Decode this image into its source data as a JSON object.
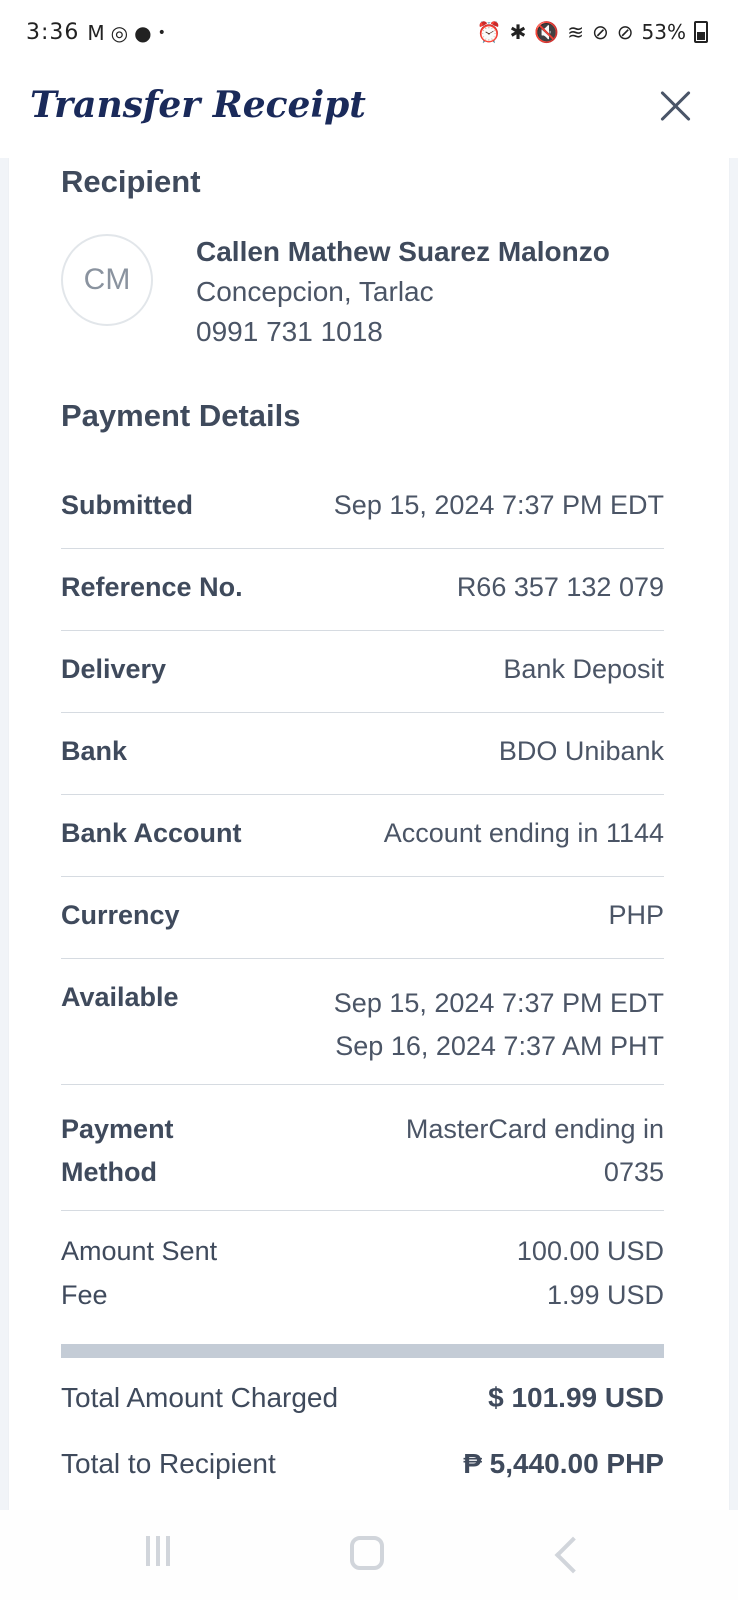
{
  "status_bar": {
    "time": "3:36",
    "left_icons": [
      "gmail-icon",
      "whatsapp-icon",
      "messenger-icon",
      "dot-icon"
    ],
    "right_icons": [
      "alarm-icon",
      "bluetooth-icon",
      "mute-icon",
      "wifi-icon",
      "block-icon",
      "block-icon"
    ],
    "battery": "53%"
  },
  "header": {
    "title": "Transfer Receipt"
  },
  "recipient": {
    "section_title": "Recipient",
    "initials": "CM",
    "name": "Callen Mathew Suarez Malonzo",
    "location": "Concepcion, Tarlac",
    "phone": "0991 731 1018"
  },
  "payment_details": {
    "section_title": "Payment Details",
    "rows": [
      {
        "label": "Submitted",
        "value": "Sep 15, 2024 7:37 PM EDT"
      },
      {
        "label": "Reference No.",
        "value": "R66 357 132 079"
      },
      {
        "label": "Delivery",
        "value": "Bank Deposit"
      },
      {
        "label": "Bank",
        "value": "BDO Unibank"
      },
      {
        "label": "Bank Account",
        "value": "Account ending in 1144"
      },
      {
        "label": "Currency",
        "value": "PHP"
      },
      {
        "label": "Available",
        "value": "Sep 15, 2024 7:37 PM EDT",
        "value2": "Sep 16, 2024 7:37 AM PHT"
      },
      {
        "label": "Payment",
        "label2": "Method",
        "value": "MasterCard ending in",
        "value2": "0735"
      }
    ],
    "amount_sent": {
      "label": "Amount Sent",
      "value": "100.00 USD"
    },
    "fee": {
      "label": "Fee",
      "value": "1.99 USD"
    },
    "total_charged": {
      "label": "Total Amount Charged",
      "value": "$ 101.99 USD"
    },
    "total_recipient": {
      "label": "Total to Recipient",
      "value": "₱ 5,440.00 PHP"
    }
  },
  "colors": {
    "title": "#1a2a5a",
    "text": "#3f4a5c",
    "divider": "#c4ccd6"
  }
}
